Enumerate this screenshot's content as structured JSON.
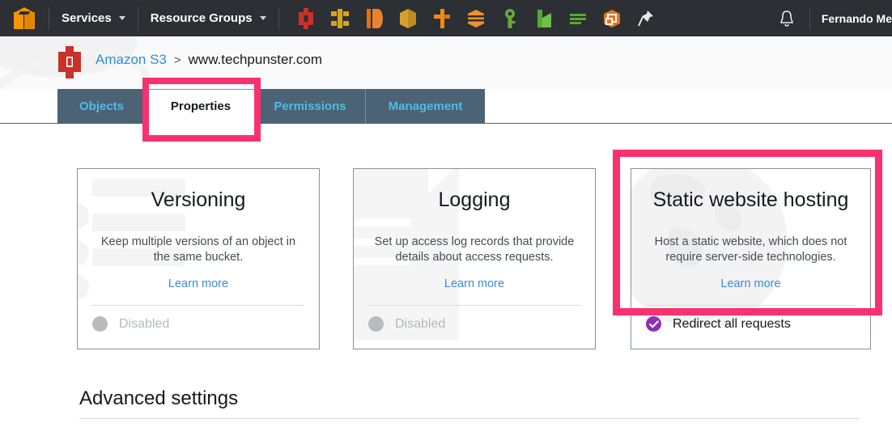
{
  "topnav": {
    "logo_name": "aws-cube-logo",
    "services_label": "Services",
    "resource_groups_label": "Resource Groups",
    "bell_name": "notifications-bell-icon",
    "pin_name": "pin-icon",
    "username": "Fernando Me",
    "service_shortcuts": [
      {
        "name": "s3-shortcut-icon",
        "color": "#c8322a"
      },
      {
        "name": "elastic-beanstalk-shortcut-icon",
        "color": "#d9a21b"
      },
      {
        "name": "dynamodb-shortcut-icon",
        "color": "#e0701a"
      },
      {
        "name": "rds-shortcut-icon",
        "color": "#d7a02a"
      },
      {
        "name": "route53-shortcut-icon",
        "color": "#f08a13"
      },
      {
        "name": "ec2-shortcut-icon",
        "color": "#f0932b"
      },
      {
        "name": "iam-shortcut-icon",
        "color": "#6aa83a"
      },
      {
        "name": "cloudwatch-shortcut-icon",
        "color": "#57a832"
      },
      {
        "name": "vpc-shortcut-icon",
        "color": "#5aa832"
      },
      {
        "name": "lambda-shortcut-icon",
        "color": "#e8731a"
      },
      {
        "name": "pin-shortcut-icon",
        "color": "#e8e8e8"
      }
    ]
  },
  "breadcrumb": {
    "icon_name": "s3-bucket-icon",
    "root_label": "Amazon S3",
    "separator": ">",
    "current_label": "www.techpunster.com"
  },
  "tabs": [
    {
      "label": "Objects",
      "active": false
    },
    {
      "label": "Properties",
      "active": true
    },
    {
      "label": "Permissions",
      "active": false
    },
    {
      "label": "Management",
      "active": false
    }
  ],
  "cards": [
    {
      "title": "Versioning",
      "description": "Keep multiple versions of an object in the same bucket.",
      "link_label": "Learn more",
      "status_label": "Disabled",
      "status_enabled": false,
      "watermark": "list-bars-watermark"
    },
    {
      "title": "Logging",
      "description": "Set up access log records that provide details about access requests.",
      "link_label": "Learn more",
      "status_label": "Disabled",
      "status_enabled": false,
      "watermark": "document-watermark"
    },
    {
      "title": "Static website hosting",
      "description": "Host a static website, which does not require server-side technologies.",
      "link_label": "Learn more",
      "status_label": "Redirect all requests",
      "status_enabled": true,
      "watermark": "globe-watermark"
    }
  ],
  "advanced": {
    "heading": "Advanced settings"
  },
  "annotations": {
    "color": "#f9316f",
    "tab_highlight": "properties-tab-highlight",
    "card_highlight": "static-website-hosting-highlight"
  }
}
